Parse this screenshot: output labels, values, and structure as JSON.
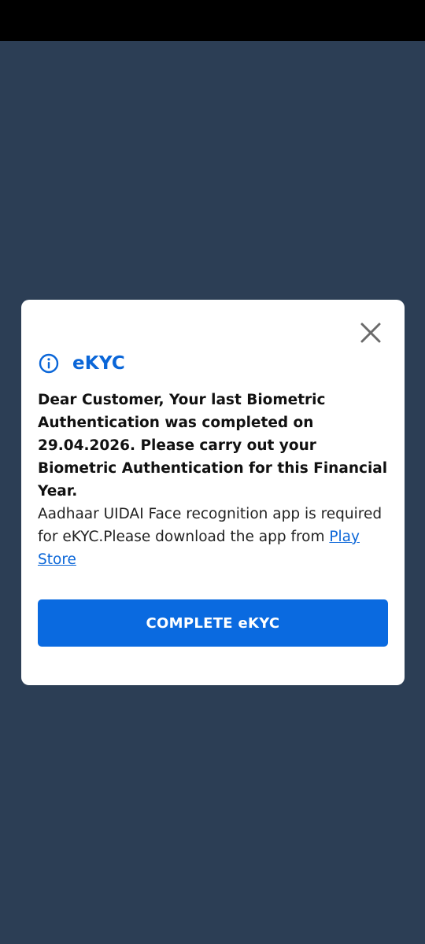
{
  "dialog": {
    "title": "eKYC",
    "title_icon": "info-circle-icon",
    "close_icon": "close-icon",
    "message_bold": "Dear Customer, Your last Biometric Authentication was completed on 29.04.2026. Please carry out your Biometric Authentication for this Financial Year.",
    "message_prefix": "Aadhaar UIDAI Face recognition app is required for eKYC.Please download the app from ",
    "link_text": "Play Store",
    "button_label": "COMPLETE eKYC"
  },
  "colors": {
    "background": "#2c3e55",
    "status_bar": "#000000",
    "accent": "#0a6ae0",
    "title": "#0a66d8"
  }
}
